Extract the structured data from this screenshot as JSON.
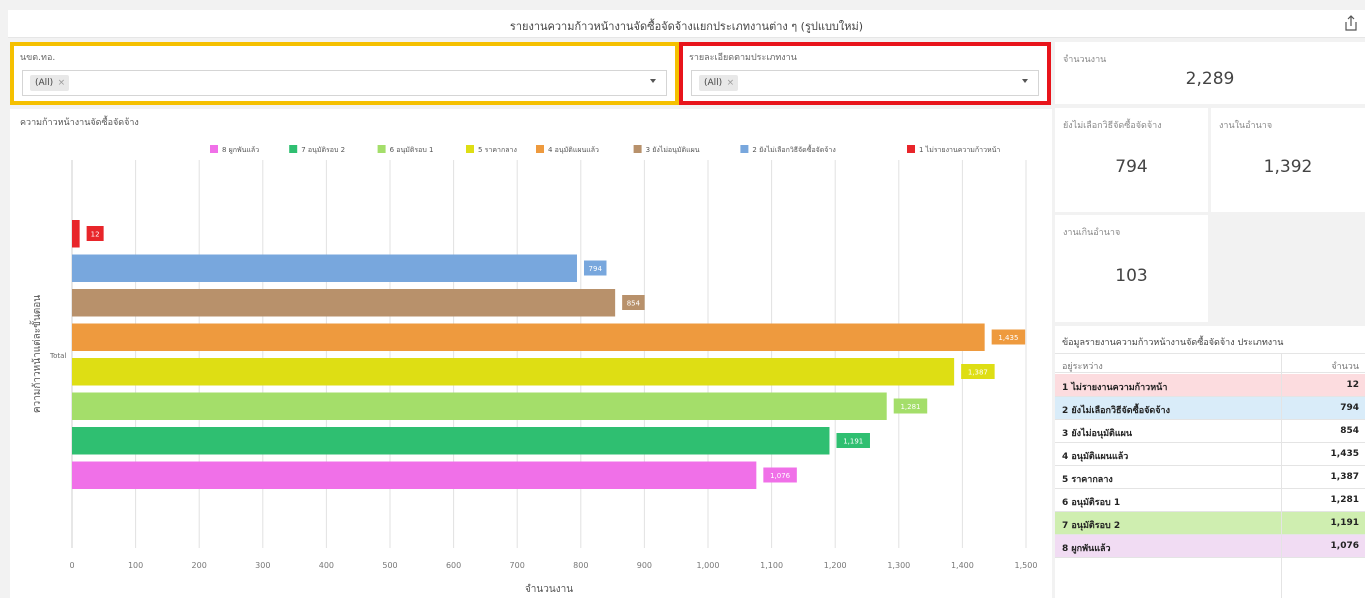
{
  "header": {
    "title": "รายงานความก้าวหน้างานจัดซื้อจัดจ้างแยกประเภทงานต่าง ๆ (รูปแบบใหม่)",
    "share_icon": "share-icon"
  },
  "filters": {
    "org": {
      "label": "นขต.ทอ.",
      "chip": "(All)",
      "chip_remove": "×"
    },
    "work_type": {
      "label": "รายละเอียดตามประเภทงาน",
      "chip": "(All)",
      "chip_remove": "×"
    }
  },
  "highlight_colors": {
    "filter_org": "#f5c000",
    "filter_work_type": "#e8141b"
  },
  "kpis": {
    "total": {
      "label": "จำนวนงาน",
      "value": "2,289"
    },
    "no_method": {
      "label": "ยังไม่เลือกวิธีจัดซื้อจัดจ้าง",
      "value": "794"
    },
    "in_authority": {
      "label": "งานในอำนาจ",
      "value": "1,392"
    },
    "over_authority": {
      "label": "งานเกินอำนาจ",
      "value": "103"
    }
  },
  "table": {
    "title": "ข้อมูลรายงานความก้าวหน้างานจัดซื้อจัดจ้าง ประเภทงาน",
    "col_status": "อยู่ระหว่าง",
    "col_count": "จำนวน",
    "rows": [
      {
        "label": "1 ไม่รายงานความก้าวหน้า",
        "value": "12",
        "bg": "#fcdcdf"
      },
      {
        "label": "2 ยังไม่เลือกวิธีจัดซื้อจัดจ้าง",
        "value": "794",
        "bg": "#d9ecf9"
      },
      {
        "label": "3 ยังไม่อนุมัติแผน",
        "value": "854",
        "bg": "#ffffff"
      },
      {
        "label": "4 อนุมัติแผนแล้ว",
        "value": "1,435",
        "bg": "#ffffff"
      },
      {
        "label": "5 ราคากลาง",
        "value": "1,387",
        "bg": "#ffffff"
      },
      {
        "label": "6 อนุมัติรอบ 1",
        "value": "1,281",
        "bg": "#ffffff"
      },
      {
        "label": "7 อนุมัติรอบ 2",
        "value": "1,191",
        "bg": "#cfeeb0"
      },
      {
        "label": "8 ผูกพันแล้ว",
        "value": "1,076",
        "bg": "#f1dcf3"
      }
    ]
  },
  "chart_data": {
    "type": "bar",
    "orientation": "horizontal",
    "title": "ความก้าวหน้างานจัดซื้อจัดจ้าง",
    "xlabel": "จำนวนงาน",
    "ylabel": "ความก้าวหน้าแต่ละขั้นตอน",
    "categories": [
      "Total"
    ],
    "xlim": [
      0,
      1500
    ],
    "x_ticks": [
      0,
      100,
      200,
      300,
      400,
      500,
      600,
      700,
      800,
      900,
      1000,
      1100,
      1200,
      1300,
      1400,
      1500
    ],
    "x_tick_labels": [
      "0",
      "100",
      "200",
      "300",
      "400",
      "500",
      "600",
      "700",
      "800",
      "900",
      "1,000",
      "1,100",
      "1,200",
      "1,300",
      "1,400",
      "1,500"
    ],
    "grid": true,
    "legend_position": "top",
    "legend": [
      {
        "name": "8 ผูกพันแล้ว",
        "color": "#f070e8"
      },
      {
        "name": "7 อนุมัติรอบ 2",
        "color": "#2fbf71"
      },
      {
        "name": "6 อนุมัติรอบ 1",
        "color": "#a4de6a"
      },
      {
        "name": "5 ราคากลาง",
        "color": "#dede14"
      },
      {
        "name": "4 อนุมัติแผนแล้ว",
        "color": "#ee9a3e"
      },
      {
        "name": "3 ยังไม่อนุมัติแผน",
        "color": "#b8916b"
      },
      {
        "name": "2 ยังไม่เลือกวิธีจัดซื้อจัดจ้าง",
        "color": "#78a7dd"
      },
      {
        "name": "1 ไม่รายงานความก้าวหน้า",
        "color": "#e8252a"
      }
    ],
    "series": [
      {
        "name": "1 ไม่รายงานความก้าวหน้า",
        "value": 12,
        "label": "12",
        "color": "#e8252a"
      },
      {
        "name": "2 ยังไม่เลือกวิธีจัดซื้อจัดจ้าง",
        "value": 794,
        "label": "794",
        "color": "#78a7dd"
      },
      {
        "name": "3 ยังไม่อนุมัติแผน",
        "value": 854,
        "label": "854",
        "color": "#b8916b"
      },
      {
        "name": "4 อนุมัติแผนแล้ว",
        "value": 1435,
        "label": "1,435",
        "color": "#ee9a3e"
      },
      {
        "name": "5 ราคากลาง",
        "value": 1387,
        "label": "1,387",
        "color": "#dede14"
      },
      {
        "name": "6 อนุมัติรอบ 1",
        "value": 1281,
        "label": "1,281",
        "color": "#a4de6a"
      },
      {
        "name": "7 อนุมัติรอบ 2",
        "value": 1191,
        "label": "1,191",
        "color": "#2fbf71"
      },
      {
        "name": "8 ผูกพันแล้ว",
        "value": 1076,
        "label": "1,076",
        "color": "#f070e8"
      }
    ]
  }
}
